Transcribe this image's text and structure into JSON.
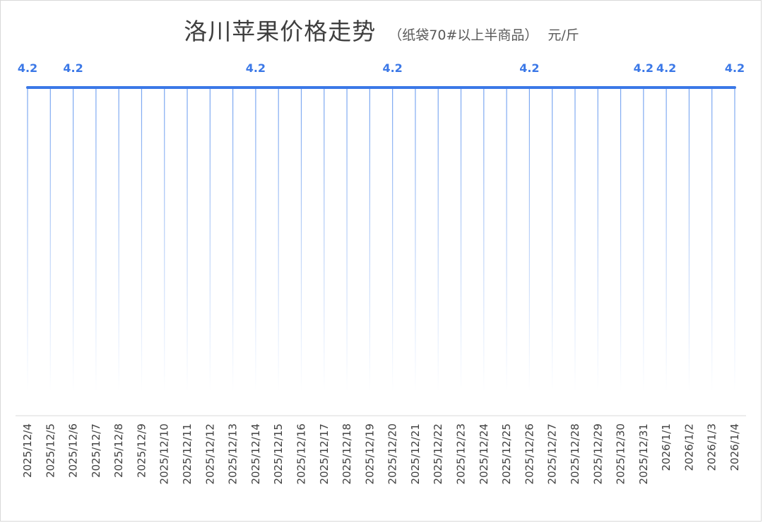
{
  "chart_data": {
    "type": "area",
    "title": "洛川苹果价格走势",
    "subtitle": "（纸袋70#以上半商品）",
    "unit": "元/斤",
    "x": [
      "2025/12/4",
      "2025/12/5",
      "2025/12/6",
      "2025/12/7",
      "2025/12/8",
      "2025/12/9",
      "2025/12/10",
      "2025/12/11",
      "2025/12/12",
      "2025/12/13",
      "2025/12/14",
      "2025/12/15",
      "2025/12/16",
      "2025/12/17",
      "2025/12/18",
      "2025/12/19",
      "2025/12/20",
      "2025/12/21",
      "2025/12/22",
      "2025/12/23",
      "2025/12/24",
      "2025/12/25",
      "2025/12/26",
      "2025/12/27",
      "2025/12/28",
      "2025/12/29",
      "2025/12/30",
      "2025/12/31",
      "2026/1/1",
      "2026/1/2",
      "2026/1/3",
      "2026/1/4"
    ],
    "series": [
      {
        "values": [
          4.2,
          4.2,
          4.2,
          4.2,
          4.2,
          4.2,
          4.2,
          4.2,
          4.2,
          4.2,
          4.2,
          4.2,
          4.2,
          4.2,
          4.2,
          4.2,
          4.2,
          4.2,
          4.2,
          4.2,
          4.2,
          4.2,
          4.2,
          4.2,
          4.2,
          4.2,
          4.2,
          4.2,
          4.2,
          4.2,
          4.2,
          4.2
        ]
      }
    ],
    "labeled_indices": [
      0,
      2,
      10,
      16,
      22,
      27,
      28,
      31
    ],
    "data_labels": [
      "4.2",
      "4.2",
      "4.2",
      "4.2",
      "4.2",
      "4.2",
      "4.2",
      "4.2"
    ],
    "ylim": [
      0,
      4.2
    ],
    "grid": false,
    "legend": "none",
    "colors": {
      "line": "#3b78e7",
      "fill_top": "#6f9ff0",
      "axis": "#d9d9d9",
      "tick_text": "#404040",
      "title_text": "#3f3f3f"
    }
  }
}
